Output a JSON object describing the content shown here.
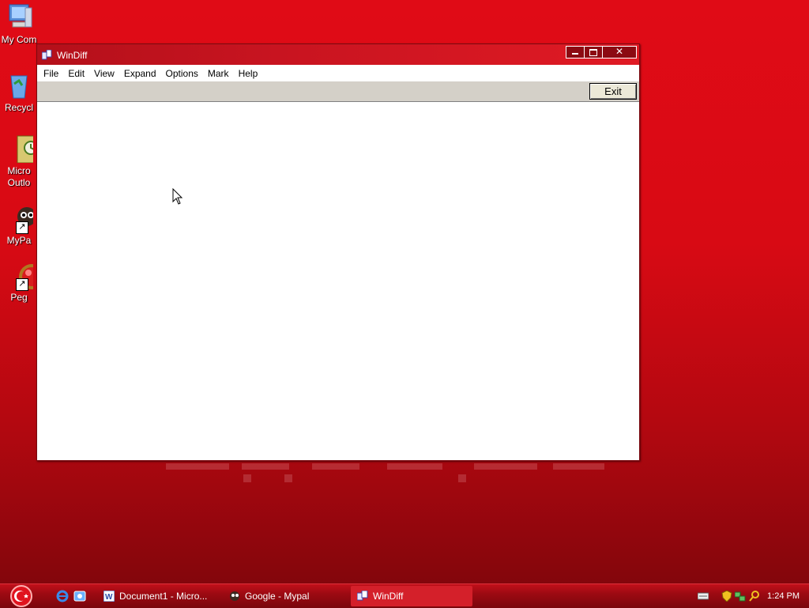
{
  "desktop": {
    "icons": [
      {
        "label": "My Com",
        "icon": "my-computer-icon"
      },
      {
        "label": "Recycl",
        "icon": "recycle-bin-icon"
      },
      {
        "label": "Micro\nOutlo",
        "icon": "outlook-icon"
      },
      {
        "label": "MyPa",
        "icon": "mypal-icon"
      },
      {
        "label": "Peg",
        "icon": "pegasus-icon"
      }
    ]
  },
  "window": {
    "title": "WinDiff",
    "menu": [
      "File",
      "Edit",
      "View",
      "Expand",
      "Options",
      "Mark",
      "Help"
    ],
    "exit_label": "Exit"
  },
  "taskbar": {
    "tasks": [
      {
        "label": "Document1 - Micro...",
        "icon": "word-icon"
      },
      {
        "label": "Google - Mypal",
        "icon": "mypal-icon"
      },
      {
        "label": "WinDiff",
        "icon": "windiff-icon"
      }
    ],
    "clock": "1:24 PM"
  },
  "colors": {
    "accent": "#e00b16",
    "taskbar": "#9c0a12"
  }
}
